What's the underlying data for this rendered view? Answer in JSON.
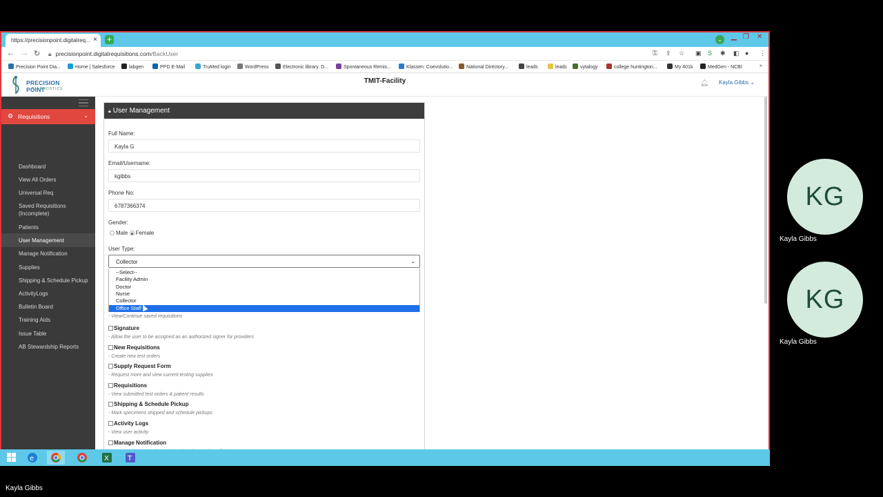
{
  "browser": {
    "tab_title": "https://precisionpoint.digitalreq...",
    "url_host": "precisionpoint.digitalrequisitions.com",
    "url_path": "/BackUser",
    "bookmarks": [
      {
        "label": "Precision Point Dia...",
        "color": "#2c6fa8"
      },
      {
        "label": "Home | Salesforce",
        "color": "#1a9bd7"
      },
      {
        "label": "labgen",
        "color": "#222222"
      },
      {
        "label": "PPD E-Mail",
        "color": "#0a64ad"
      },
      {
        "label": "TruMed login",
        "color": "#3ba5d6"
      },
      {
        "label": "WordPress",
        "color": "#777777"
      },
      {
        "label": "Electronic library. D...",
        "color": "#555555"
      },
      {
        "label": "Spontaneous Remis...",
        "color": "#7b3fa0"
      },
      {
        "label": "Klassen: Coevolutio...",
        "color": "#2b7bd1"
      },
      {
        "label": "National Directory...",
        "color": "#8b5a2b"
      },
      {
        "label": "leads",
        "color": "#444444"
      },
      {
        "label": "leads",
        "color": "#e6c34a"
      },
      {
        "label": "vytalogy",
        "color": "#4b6b2a"
      },
      {
        "label": "college huntington...",
        "color": "#a8322d"
      },
      {
        "label": "My 401k",
        "color": "#333333"
      },
      {
        "label": "MedGen - NCBI",
        "color": "#222222"
      }
    ]
  },
  "app": {
    "logo_line1": "PRECISION POINT",
    "logo_line2": "DIAGNOSTICS",
    "facility": "TMIT-Facility",
    "user": "Kayla Gibbs"
  },
  "sidebar": {
    "section": "Requisitions",
    "items": [
      "Dashboard",
      "View All Orders",
      "Universal Req",
      "Saved Requisitions (Incomplete)",
      "Patients",
      "User Management",
      "Manage Notification",
      "Supplies",
      "Shipping & Schedule Pickup",
      "ActivityLogs",
      "Bulletin Board",
      "Training Aids",
      "Issue Table",
      "AB Stewardship Reports"
    ],
    "active_index": 5
  },
  "form": {
    "title": "User Management",
    "full_name_label": "Full Name:",
    "full_name": "Kayla G",
    "email_label": "Email/Username:",
    "email": "kgibbs",
    "phone_label": "Phone No:",
    "phone": "6787366374",
    "gender_label": "Gender:",
    "gender_male": "Male",
    "gender_female": "Female",
    "gender_selected": "Female",
    "user_type_label": "User Type:",
    "user_type_value": "Collector",
    "user_type_options": [
      "--Select--",
      "Facility Admin",
      "Doctor",
      "Nurse",
      "Collector",
      "Office Staff"
    ],
    "user_type_highlighted": 5,
    "partial_desc": "- View/Continue saved requisitions",
    "permissions": [
      {
        "title": "Signature",
        "desc": "- Allow the user to be assigned as an authorized signer for providers"
      },
      {
        "title": "New Requisitions",
        "desc": "- Create new test orders"
      },
      {
        "title": "Supply Request Form",
        "desc": "- Request more and view current testing supplies"
      },
      {
        "title": "Requisitions",
        "desc": "- View submitted test orders & patient results"
      },
      {
        "title": "Shipping & Schedule Pickup",
        "desc": "- Mark specimens shipped and schedule pickups"
      },
      {
        "title": "Activity Logs",
        "desc": "- View user activity"
      },
      {
        "title": "Manage Notification",
        "desc": "- Manage the users who are signed up for email notifications"
      }
    ]
  },
  "meeting": {
    "tiles": [
      {
        "initials": "KG",
        "name": "Kayla Gibbs"
      },
      {
        "initials": "KG",
        "name": "Kayla Gibbs"
      }
    ],
    "self_name": "Kayla Gibbs"
  },
  "colors": {
    "accent_red": "#e0473f",
    "sidebar_bg": "#3a3a3a",
    "taskbar": "#5ec8e8",
    "avatar_bg": "#d3ebdc"
  }
}
